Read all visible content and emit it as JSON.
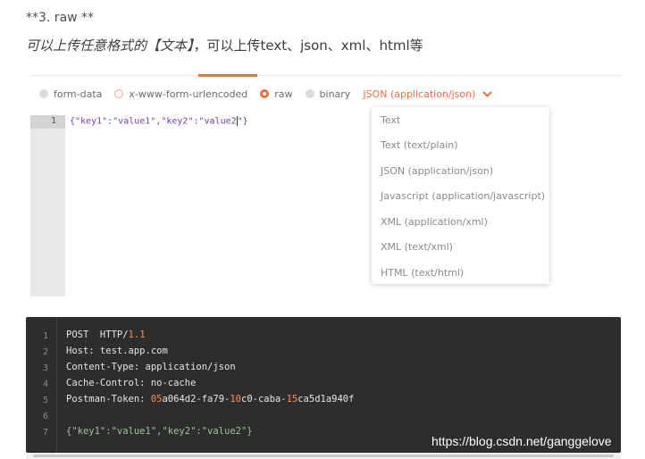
{
  "article": {
    "heading": "**3. raw **",
    "desc_em": "可以上传任意格式的【文本】",
    "desc_rest": "，可以上传text、json、xml、html等"
  },
  "body_types": [
    {
      "label": "form-data",
      "state": "off"
    },
    {
      "label": "x-www-form-urlencoded",
      "state": "empty"
    },
    {
      "label": "raw",
      "state": "checked"
    },
    {
      "label": "binary",
      "state": "off"
    }
  ],
  "content_type_select": {
    "value": "JSON (application/json)",
    "icon": "chevron-down-icon"
  },
  "editor": {
    "line_number": "1",
    "parts": [
      "{\"key1\":\"value1\",\"key2\":\"value2",
      "\"}"
    ]
  },
  "dropdown": {
    "options": [
      "Text",
      "Text (text/plain)",
      "JSON (application/json)",
      "Javascript (application/javascript)",
      "XML (application/xml)",
      "XML (text/xml)",
      "HTML (text/html)"
    ]
  },
  "request_preview": {
    "line_numbers": [
      "1",
      "2",
      "3",
      "4",
      "5",
      "6",
      "7"
    ],
    "line1": {
      "a": "POST  HTTP/",
      "num": "1.1"
    },
    "line2": "Host: test.app.com",
    "line3": "Content-Type: application/json",
    "line4": "Cache-Control: no-cache",
    "line5": {
      "a": "Postman-Token: ",
      "n1": "05",
      "b": "a064d2-fa79-",
      "n2": "10",
      "c": "c0-caba-",
      "n3": "15",
      "d": "ca5d1a940f"
    },
    "line7": "{\"key1\":\"value1\",\"key2\":\"value2\"}"
  },
  "watermark": "https://blog.csdn.net/ganggelove",
  "colors": {
    "accent": "#f26b3a",
    "code_bg": "#2d2d2d",
    "string": "#99c794",
    "number": "#f99157"
  }
}
